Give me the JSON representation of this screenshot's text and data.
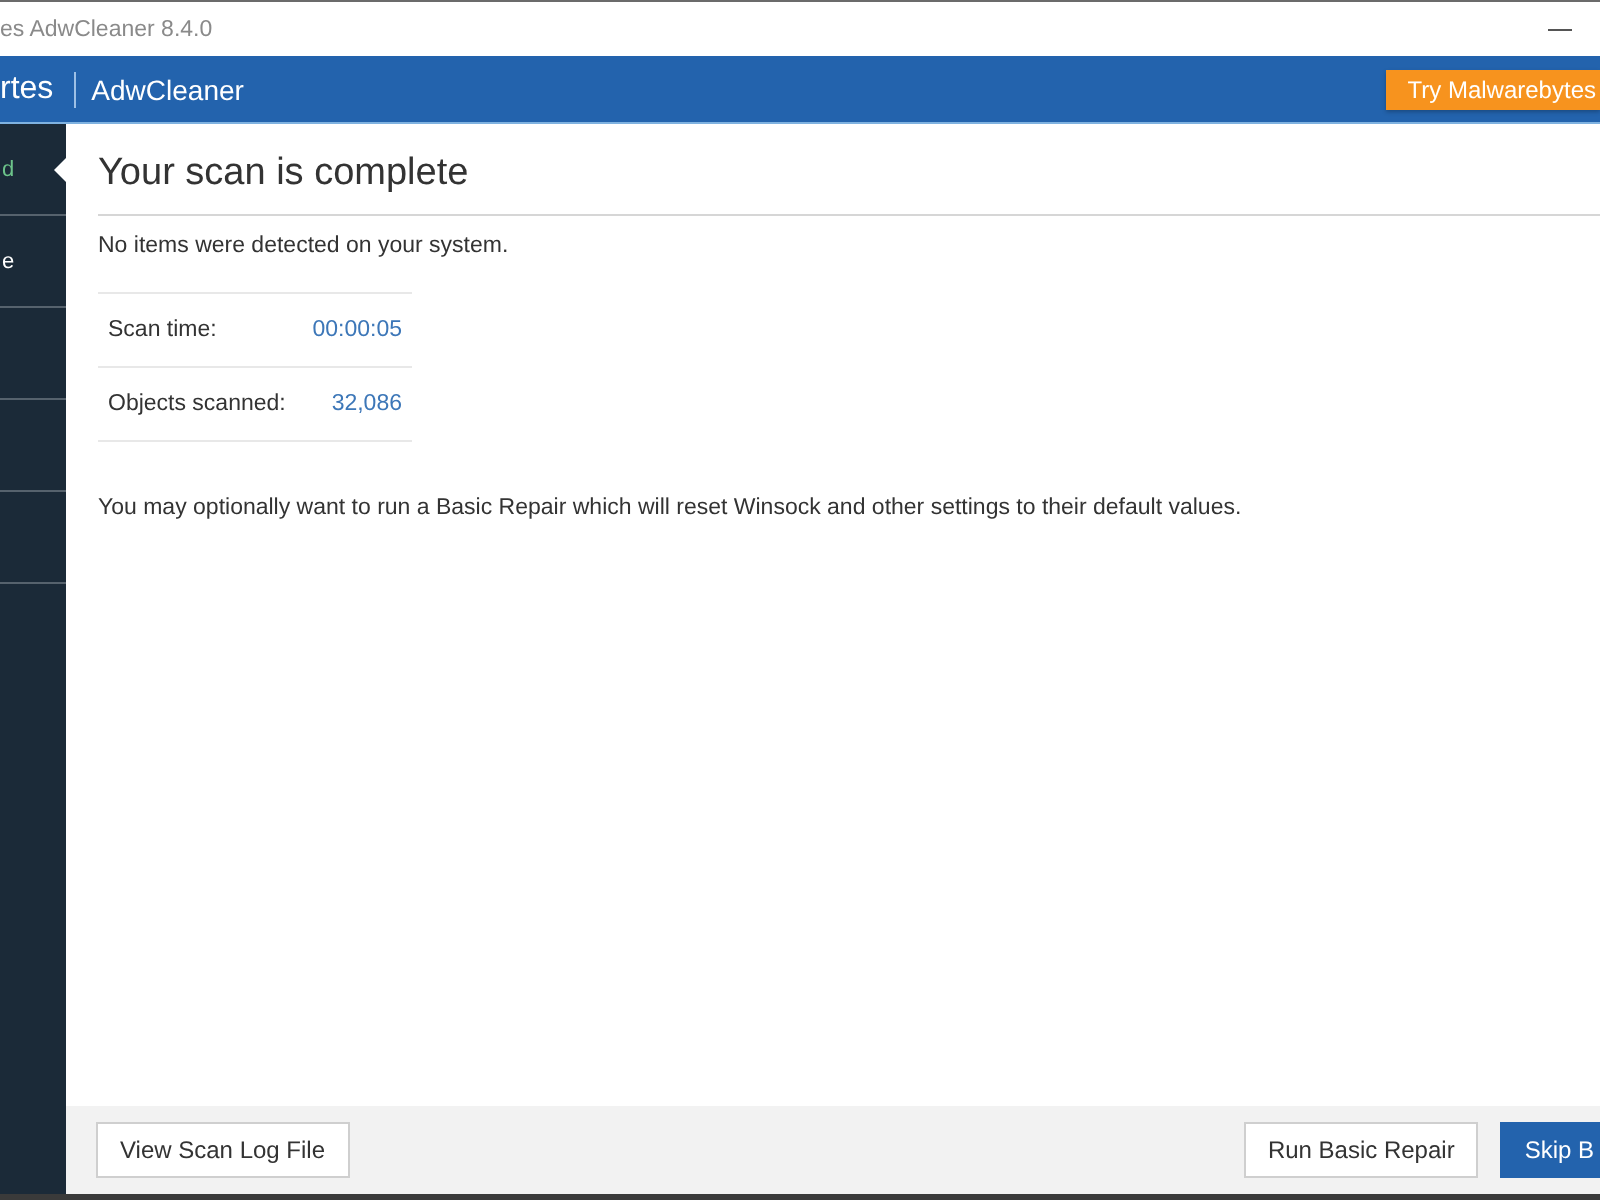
{
  "window": {
    "title": "es AdwCleaner 8.4.0"
  },
  "header": {
    "brand": "rtes",
    "product": "AdwCleaner",
    "promo_button": "Try Malwarebytes"
  },
  "sidebar": {
    "items": [
      {
        "label": "d",
        "selected": true
      },
      {
        "label": "e",
        "selected": false
      }
    ]
  },
  "content": {
    "title": "Your scan is complete",
    "summary": "No items were detected on your system.",
    "stats": [
      {
        "label": "Scan time:",
        "value": "00:00:05"
      },
      {
        "label": "Objects scanned:",
        "value": "32,086"
      }
    ],
    "note": "You may optionally want to run a Basic Repair which will reset Winsock and other settings to their default values."
  },
  "footer": {
    "left_buttons": [
      {
        "label": "View Scan Log File",
        "kind": "secondary"
      }
    ],
    "right_buttons": [
      {
        "label": "Run Basic Repair",
        "kind": "secondary"
      },
      {
        "label": "Skip B",
        "kind": "primary"
      }
    ]
  }
}
